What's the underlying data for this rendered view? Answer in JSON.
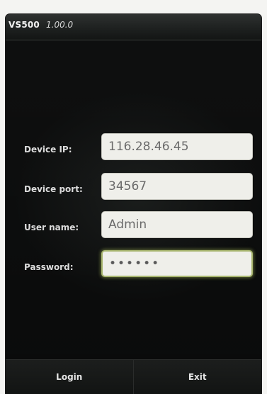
{
  "header": {
    "app_name": "VS500",
    "version": "1.00.0"
  },
  "form": {
    "device_ip": {
      "label": "Device IP:",
      "value": "116.28.46.45"
    },
    "device_port": {
      "label": "Device port:",
      "value": "34567"
    },
    "user_name": {
      "label": "User name:",
      "value": "Admin"
    },
    "password": {
      "label": "Password:",
      "value": "••••••"
    }
  },
  "footer": {
    "login_label": "Login",
    "exit_label": "Exit"
  },
  "colors": {
    "background": "#0a0b0b",
    "field_background": "#efefea",
    "focus_ring": "#a7b56e"
  }
}
